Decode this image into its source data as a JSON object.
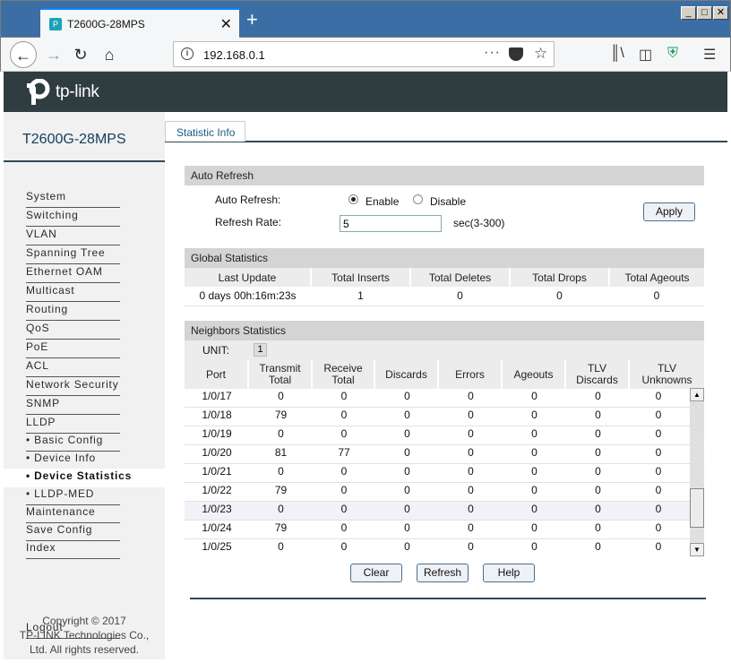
{
  "browser": {
    "tab_title": "T2600G-28MPS",
    "tab_close": "✕",
    "new_tab": "+",
    "url": "192.168.0.1",
    "window_buttons": [
      "_",
      "□",
      "✕"
    ]
  },
  "brand": {
    "logo_text": "tp-link"
  },
  "device_model": "T2600G-28MPS",
  "nav": {
    "items": [
      {
        "label": "System"
      },
      {
        "label": "Switching"
      },
      {
        "label": "VLAN"
      },
      {
        "label": "Spanning Tree"
      },
      {
        "label": "Ethernet OAM"
      },
      {
        "label": "Multicast"
      },
      {
        "label": "Routing"
      },
      {
        "label": "QoS"
      },
      {
        "label": "PoE"
      },
      {
        "label": "ACL"
      },
      {
        "label": "Network Security"
      },
      {
        "label": "SNMP"
      },
      {
        "label": "LLDP"
      },
      {
        "label": "• Basic Config"
      },
      {
        "label": "• Device Info"
      },
      {
        "label": "• Device Statistics",
        "active": true
      },
      {
        "label": "• LLDP-MED"
      },
      {
        "label": "Maintenance"
      },
      {
        "label": "Save Config"
      },
      {
        "label": "Index"
      }
    ],
    "logout": "Logout"
  },
  "copyright": {
    "line1": "Copyright © 2017",
    "line2": "TP-LINK Technologies Co.,",
    "line3": "Ltd. All rights reserved."
  },
  "tab_label": "Statistic Info",
  "auto_refresh": {
    "section_title": "Auto Refresh",
    "label": "Auto Refresh:",
    "enable_label": "Enable",
    "disable_label": "Disable",
    "selected": "Enable",
    "rate_label": "Refresh Rate:",
    "rate_value": "5",
    "rate_hint": "sec(3-300)",
    "apply_label": "Apply"
  },
  "global_stats": {
    "section_title": "Global Statistics",
    "headers": [
      "Last Update",
      "Total Inserts",
      "Total Deletes",
      "Total Drops",
      "Total Ageouts"
    ],
    "row": [
      "0 days 00h:16m:23s",
      "1",
      "0",
      "0",
      "0"
    ]
  },
  "neighbors": {
    "section_title": "Neighbors Statistics",
    "unit_label": "UNIT:",
    "unit_value": "1",
    "headers": [
      "Port",
      "Transmit\nTotal",
      "Receive\nTotal",
      "Discards",
      "Errors",
      "Ageouts",
      "TLV\nDiscards",
      "TLV\nUnknowns"
    ],
    "rows": [
      [
        "1/0/17",
        "0",
        "0",
        "0",
        "0",
        "0",
        "0",
        "0"
      ],
      [
        "1/0/18",
        "79",
        "0",
        "0",
        "0",
        "0",
        "0",
        "0"
      ],
      [
        "1/0/19",
        "0",
        "0",
        "0",
        "0",
        "0",
        "0",
        "0"
      ],
      [
        "1/0/20",
        "81",
        "77",
        "0",
        "0",
        "0",
        "0",
        "0"
      ],
      [
        "1/0/21",
        "0",
        "0",
        "0",
        "0",
        "0",
        "0",
        "0"
      ],
      [
        "1/0/22",
        "79",
        "0",
        "0",
        "0",
        "0",
        "0",
        "0"
      ],
      [
        "1/0/23",
        "0",
        "0",
        "0",
        "0",
        "0",
        "0",
        "0"
      ],
      [
        "1/0/24",
        "79",
        "0",
        "0",
        "0",
        "0",
        "0",
        "0"
      ],
      [
        "1/0/25",
        "0",
        "0",
        "0",
        "0",
        "0",
        "0",
        "0"
      ]
    ],
    "highlighted_port": "1/0/23"
  },
  "actions": {
    "clear_label": "Clear",
    "refresh_label": "Refresh",
    "help_label": "Help"
  },
  "colors": {
    "brand_bar": "#2f3c40",
    "accent": "#2f4a55",
    "titlebar": "#3a6ea5"
  }
}
